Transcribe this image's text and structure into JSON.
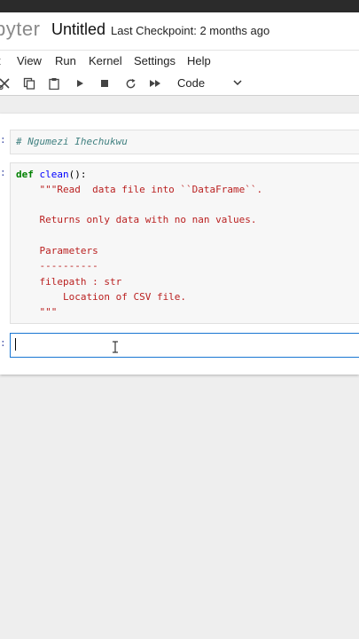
{
  "app": {
    "logo_text": "pyter",
    "notebook_title": "Untitled",
    "checkpoint": "Last Checkpoint: 2 months ago"
  },
  "menu": [
    "t",
    "View",
    "Run",
    "Kernel",
    "Settings",
    "Help"
  ],
  "toolbar": {
    "icons": [
      "cut-icon",
      "copy-icon",
      "paste-icon",
      "run-icon",
      "stop-icon",
      "restart-icon",
      "fast-forward-icon"
    ],
    "cell_type": "Code"
  },
  "cells": {
    "markdown": {
      "prompt": ":",
      "text": "# Ngumezi Ihechukwu"
    },
    "code": {
      "prompt": ":",
      "lines": [
        [
          "def",
          " ",
          "clean",
          "():"
        ],
        "    \"\"\"Read  data file into ``DataFrame``.",
        "",
        "    Returns only data with no nan values.",
        "",
        "    Parameters",
        "    ----------",
        "    filepath : str",
        "        Location of CSV file.",
        "    \"\"\""
      ]
    },
    "active": {
      "prompt": ":",
      "value": ""
    }
  }
}
